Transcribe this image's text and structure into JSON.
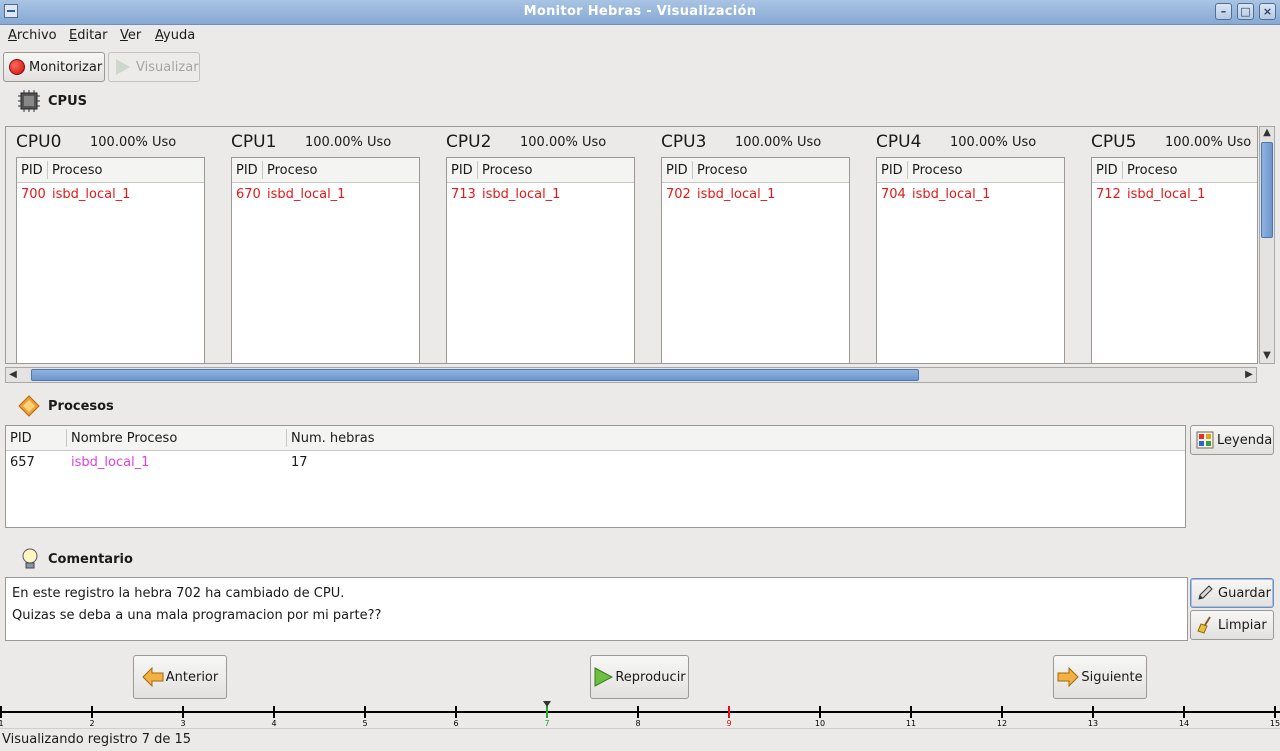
{
  "window": {
    "title": "Monitor Hebras - Visualización"
  },
  "menu": [
    {
      "label": "Archivo",
      "mnemonic": "A",
      "rest": "rchivo"
    },
    {
      "label": "Editar",
      "mnemonic": "E",
      "rest": "ditar"
    },
    {
      "label": "Ver",
      "mnemonic": "V",
      "rest": "er"
    },
    {
      "label": "Ayuda",
      "mnemonic": "A",
      "rest": "yuda"
    }
  ],
  "toolbar": {
    "monitor_label": "Monitorizar",
    "view_label": "Visualizar"
  },
  "cpus": {
    "section_label": "CPUS",
    "col_pid": "PID",
    "col_proc": "Proceso",
    "items": [
      {
        "name": "CPU0",
        "usage": "100.00% Uso",
        "pid": "700",
        "proc": "isbd_local_1"
      },
      {
        "name": "CPU1",
        "usage": "100.00% Uso",
        "pid": "670",
        "proc": "isbd_local_1"
      },
      {
        "name": "CPU2",
        "usage": "100.00% Uso",
        "pid": "713",
        "proc": "isbd_local_1"
      },
      {
        "name": "CPU3",
        "usage": "100.00% Uso",
        "pid": "702",
        "proc": "isbd_local_1"
      },
      {
        "name": "CPU4",
        "usage": "100.00% Uso",
        "pid": "704",
        "proc": "isbd_local_1"
      },
      {
        "name": "CPU5",
        "usage": "100.00% Uso",
        "pid": "712",
        "proc": "isbd_local_1"
      }
    ]
  },
  "procesos": {
    "section_label": "Procesos",
    "headers": {
      "pid": "PID",
      "name": "Nombre Proceso",
      "threads": "Num. hebras"
    },
    "rows": [
      {
        "pid": "657",
        "name": "isbd_local_1",
        "threads": "17"
      }
    ],
    "legend_label": "Leyenda"
  },
  "comentario": {
    "section_label": "Comentario",
    "lines": [
      "En este registro la hebra 702 ha cambiado de CPU.",
      "Quizas se deba a una mala programacion por mi parte??"
    ],
    "save_label": "Guardar",
    "clear_label": "Limpiar"
  },
  "navigation": {
    "prev_label": "Anterior",
    "play_label": "Reproducir",
    "next_label": "Siguiente"
  },
  "timeline": {
    "ticks": [
      "1",
      "2",
      "3",
      "4",
      "5",
      "6",
      "7",
      "8",
      "9",
      "10",
      "11",
      "12",
      "13",
      "14",
      "15"
    ],
    "current": 7,
    "marked": 9
  },
  "status": {
    "text": "Visualizando registro 7 de 15"
  },
  "colors": {
    "thread": "#e41818",
    "process": "#e040e0",
    "current_marker": "#22aa22",
    "marked": "#dd1111"
  }
}
